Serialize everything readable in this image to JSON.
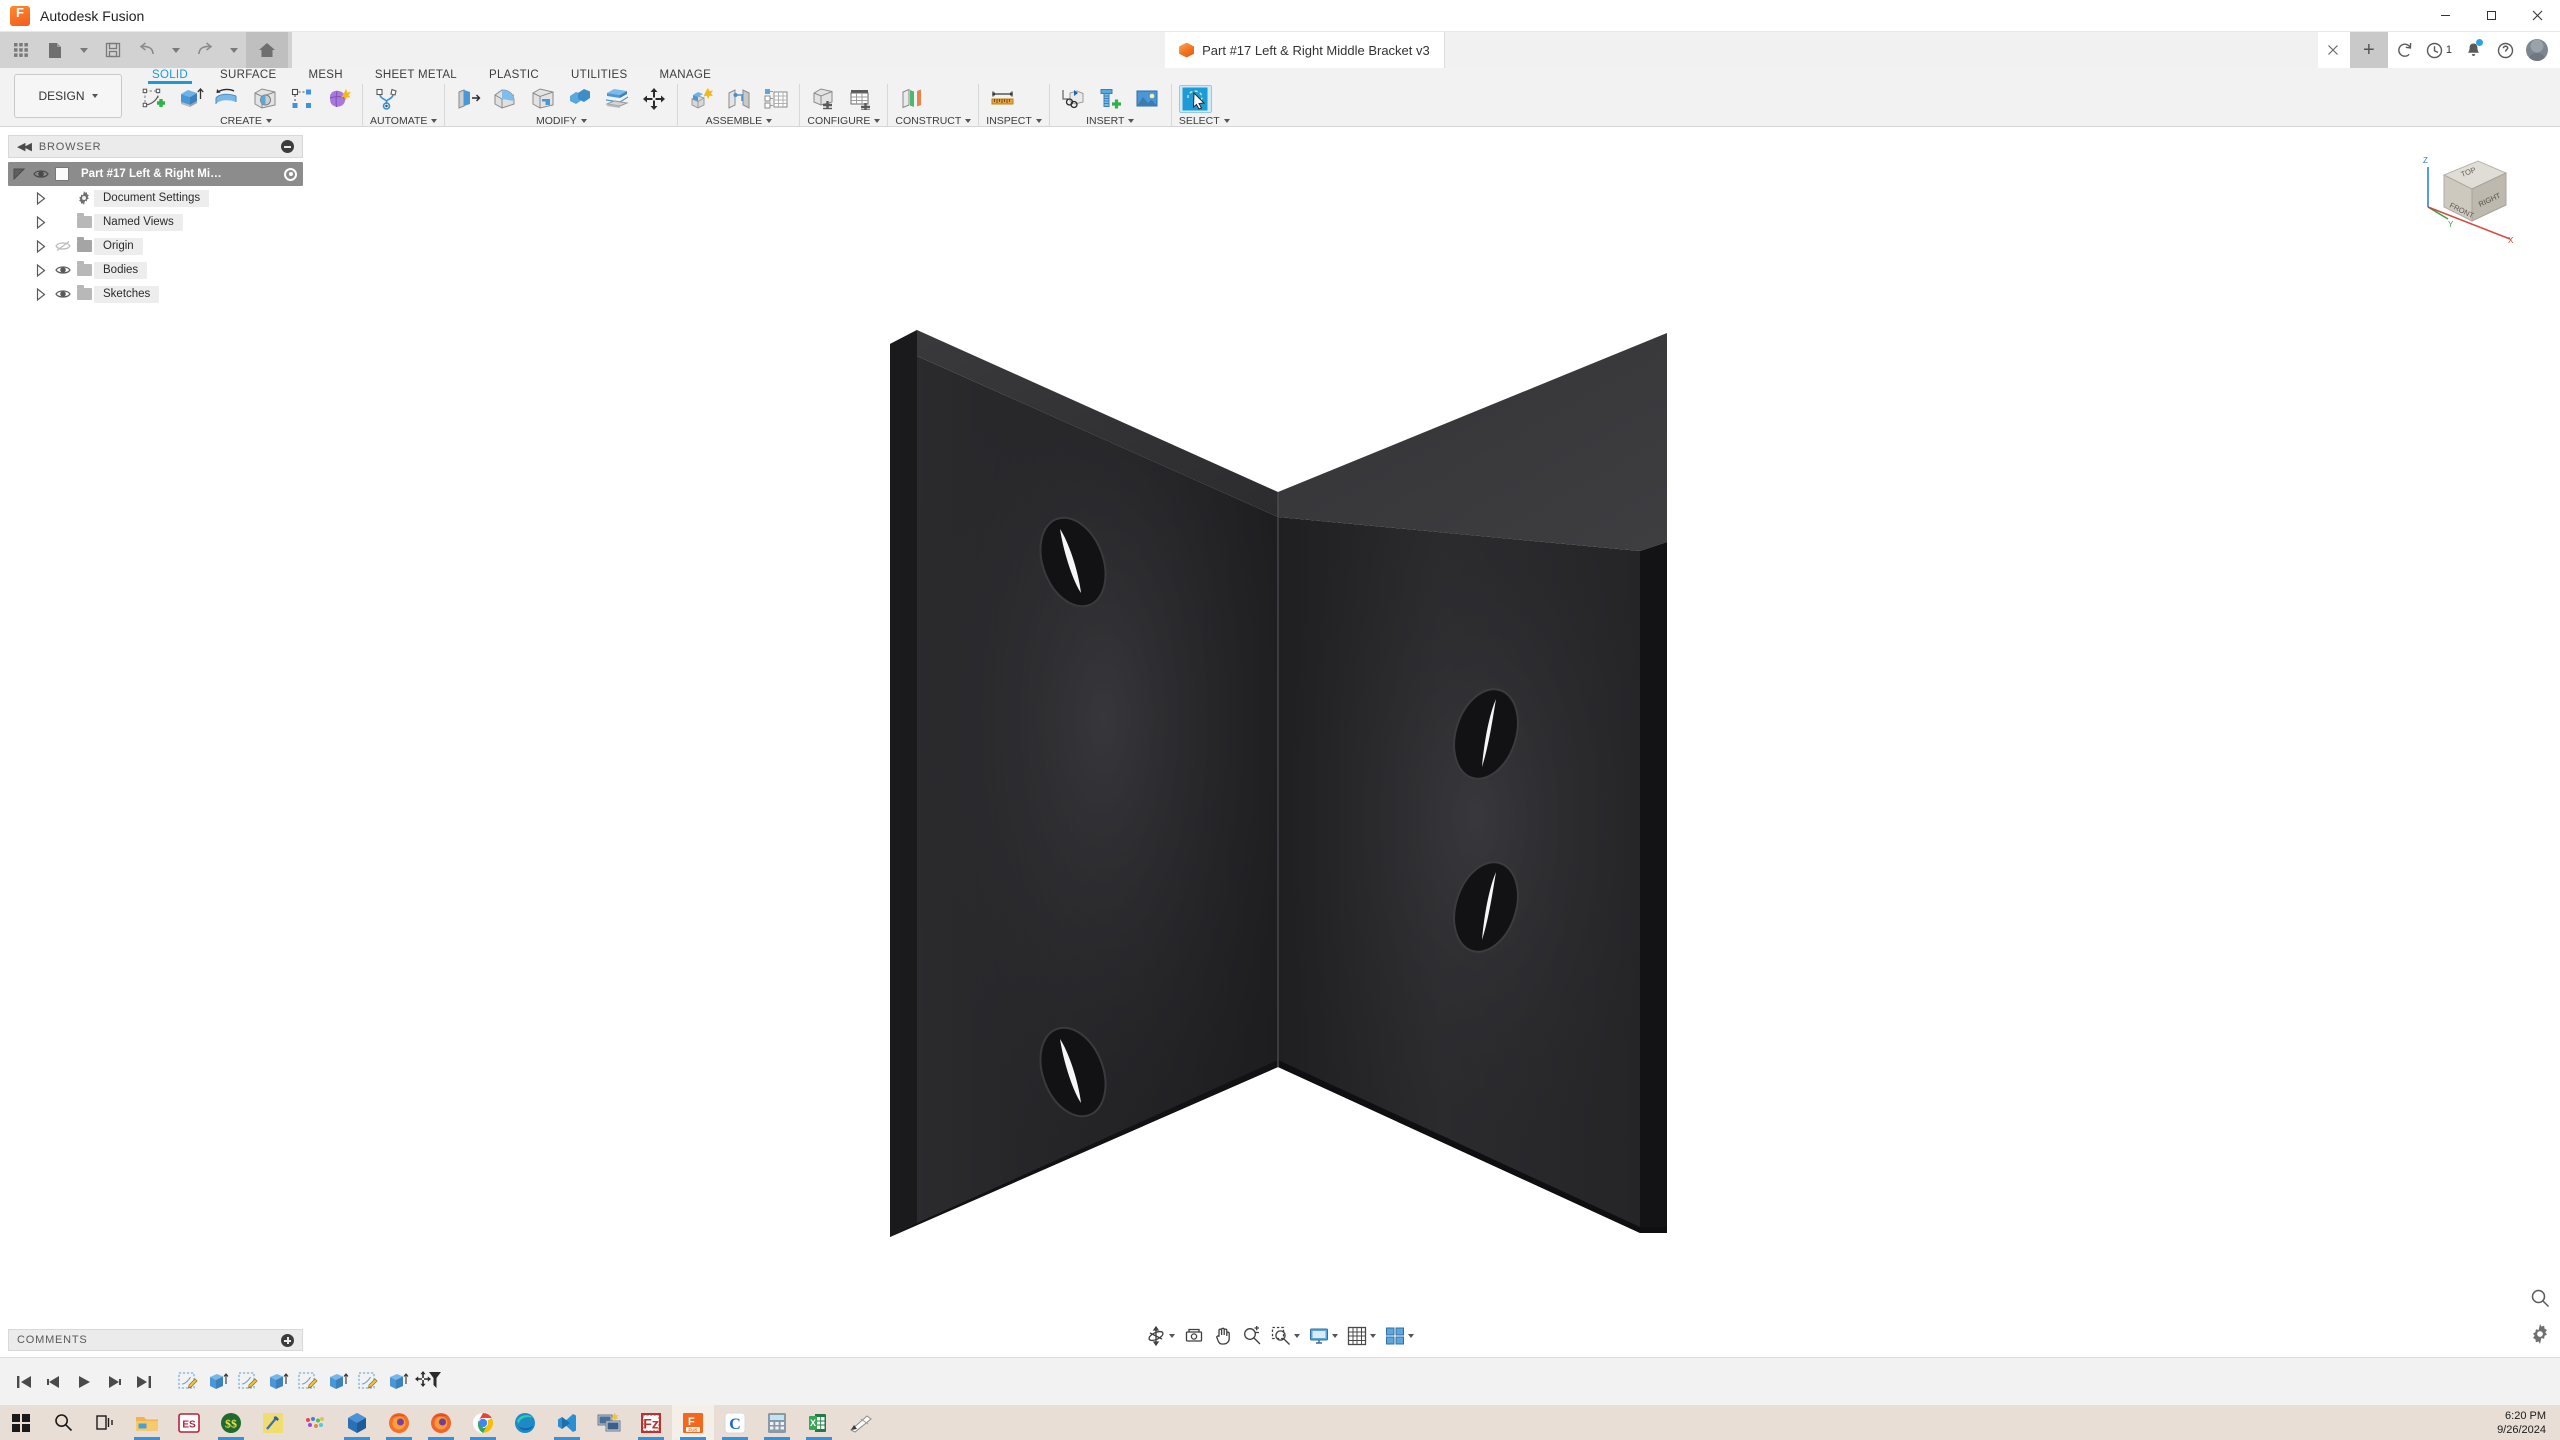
{
  "window": {
    "app_name": "Autodesk Fusion",
    "app_icon": "fusion-logo-icon",
    "minimize": "─",
    "maximize": "□",
    "close": "✕"
  },
  "quick_access": {
    "grid_label": "app-grid-icon",
    "new_label": "new-document-icon",
    "save_label": "save-icon",
    "undo_label": "undo-icon",
    "redo_label": "redo-icon",
    "home_label": "home-icon"
  },
  "document_tab": {
    "title": "Part #17 Left & Right Middle Bracket v3",
    "close": "✕"
  },
  "tabs_right": {
    "new_tab": "+",
    "refresh": "sync-icon",
    "history_count": "1",
    "notifications": "bell-icon",
    "help": "?",
    "account": "avatar"
  },
  "workspace_selector": {
    "label": "DESIGN"
  },
  "ribbon": {
    "tabs": [
      {
        "label": "SOLID",
        "active": true
      },
      {
        "label": "SURFACE",
        "active": false
      },
      {
        "label": "MESH",
        "active": false
      },
      {
        "label": "SHEET METAL",
        "active": false
      },
      {
        "label": "PLASTIC",
        "active": false
      },
      {
        "label": "UTILITIES",
        "active": false
      },
      {
        "label": "MANAGE",
        "active": false
      }
    ],
    "groups": [
      {
        "label": "CREATE",
        "has_caret": true,
        "tools": [
          "create-sketch-icon",
          "extrude-icon",
          "revolve-icon",
          "hole-icon",
          "rectangular-pattern-icon",
          "create-form-icon"
        ]
      },
      {
        "label": "AUTOMATE",
        "has_caret": true,
        "tools": [
          "automated-modeling-icon"
        ]
      },
      {
        "label": "MODIFY",
        "has_caret": true,
        "tools": [
          "press-pull-icon",
          "fillet-icon",
          "shell-icon",
          "combine-icon",
          "split-face-icon",
          "move-copy-icon"
        ]
      },
      {
        "label": "ASSEMBLE",
        "has_caret": true,
        "tools": [
          "new-component-icon",
          "joint-icon",
          "bill-of-materials-icon"
        ]
      },
      {
        "label": "CONFIGURE",
        "has_caret": true,
        "tools": [
          "create-configuration-icon",
          "configuration-table-icon"
        ]
      },
      {
        "label": "CONSTRUCT",
        "has_caret": true,
        "tools": [
          "offset-plane-icon"
        ]
      },
      {
        "label": "INSPECT",
        "has_caret": true,
        "tools": [
          "measure-icon"
        ]
      },
      {
        "label": "INSERT",
        "has_caret": true,
        "tools": [
          "insert-derive-icon",
          "insert-mcmaster-icon",
          "insert-image-icon"
        ]
      },
      {
        "label": "SELECT",
        "has_caret": true,
        "tools": [
          "select-tool-icon"
        ]
      }
    ]
  },
  "browser": {
    "header": "BROWSER",
    "collapse_icon": "collapse-left-icon",
    "minimize_icon": "minus-circle-icon",
    "items": [
      {
        "label": "Part #17 Left & Right Middle B...",
        "icon": "component-icon",
        "expanded": true,
        "visible": true,
        "selected": true,
        "indent": 0,
        "has_radio": true
      },
      {
        "label": "Document Settings",
        "icon": "gear-icon",
        "expanded": false,
        "visible": null,
        "selected": false,
        "indent": 1,
        "has_radio": false
      },
      {
        "label": "Named Views",
        "icon": "folder-icon",
        "expanded": false,
        "visible": null,
        "selected": false,
        "indent": 1,
        "has_radio": false
      },
      {
        "label": "Origin",
        "icon": "folder-icon",
        "expanded": false,
        "visible": false,
        "selected": false,
        "indent": 1,
        "has_radio": false
      },
      {
        "label": "Bodies",
        "icon": "folder-icon",
        "expanded": false,
        "visible": true,
        "selected": false,
        "indent": 1,
        "has_radio": false
      },
      {
        "label": "Sketches",
        "icon": "folder-icon",
        "expanded": false,
        "visible": true,
        "selected": false,
        "indent": 1,
        "has_radio": false
      }
    ]
  },
  "comments": {
    "header": "COMMENTS",
    "add_icon": "plus-circle-icon"
  },
  "viewcube": {
    "top_face": "TOP",
    "front_face": "FRONT",
    "right_face": "RIGHT",
    "axis_z": "Z",
    "axis_y": "Y",
    "axis_x": "X"
  },
  "navigation_bar": {
    "buttons": [
      {
        "name": "orbit-icon",
        "has_caret": true
      },
      {
        "name": "look-at-icon",
        "has_caret": false
      },
      {
        "name": "pan-hand-icon",
        "has_caret": false
      },
      {
        "name": "zoom-icon",
        "has_caret": false
      },
      {
        "name": "fit-icon",
        "has_caret": true
      },
      {
        "name": "display-settings-icon",
        "has_caret": true
      },
      {
        "name": "grid-snap-icon",
        "has_caret": true
      },
      {
        "name": "viewports-icon",
        "has_caret": true
      }
    ]
  },
  "viewport_extras": {
    "search_zoom_icon": "magnify-icon",
    "settings_gear_icon": "gear-icon"
  },
  "timeline": {
    "playback": [
      "skip-to-start-icon",
      "step-back-icon",
      "play-icon",
      "step-forward-icon",
      "skip-to-end-icon"
    ],
    "features": [
      "sketch-feature-icon",
      "extrude-feature-icon",
      "sketch-feature-icon",
      "extrude-feature-icon",
      "sketch-feature-icon",
      "extrude-feature-icon",
      "sketch-feature-icon",
      "extrude-feature-icon"
    ],
    "end_marker": "timeline-marker-icon"
  },
  "model": {
    "description": "black L-shaped angle bracket with four countersunk holes",
    "body_color": "#27272a",
    "edge_highlight": "#4a4a4d",
    "hole_highlight": "#ffffff"
  },
  "taskbar": {
    "start": "windows-start-icon",
    "items": [
      {
        "name": "search-icon",
        "running": false
      },
      {
        "name": "task-view-icon",
        "running": false
      },
      {
        "name": "file-explorer-icon",
        "running": true
      },
      {
        "name": "everything-search-icon",
        "running": false
      },
      {
        "name": "simplewall-icon",
        "running": true
      },
      {
        "name": "snipping-tool-icon",
        "running": false
      },
      {
        "name": "paint-icon",
        "running": false
      },
      {
        "name": "virtualbox-icon",
        "running": true
      },
      {
        "name": "firefox-icon",
        "running": true
      },
      {
        "name": "firefox-dev-icon",
        "running": true
      },
      {
        "name": "chrome-icon",
        "running": true
      },
      {
        "name": "edge-icon",
        "running": false
      },
      {
        "name": "vscode-icon",
        "running": true
      },
      {
        "name": "remote-desktop-icon",
        "running": false
      },
      {
        "name": "filezilla-icon",
        "running": true
      },
      {
        "name": "fusion-icon",
        "running": true,
        "active": true
      },
      {
        "name": "calibre-icon",
        "running": true
      },
      {
        "name": "calculator-icon",
        "running": true
      },
      {
        "name": "excel-icon",
        "running": true
      },
      {
        "name": "sketch-app-icon",
        "running": false
      }
    ],
    "clock_time": "6:20 PM",
    "clock_date": "9/26/2024"
  }
}
